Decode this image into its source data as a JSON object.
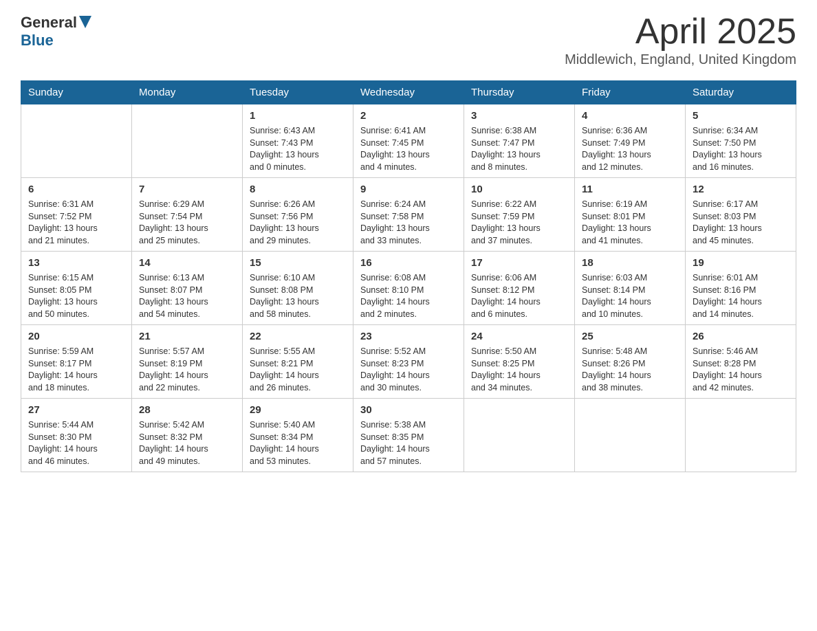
{
  "header": {
    "logo_general": "General",
    "logo_blue": "Blue",
    "title": "April 2025",
    "location": "Middlewich, England, United Kingdom"
  },
  "days_of_week": [
    "Sunday",
    "Monday",
    "Tuesday",
    "Wednesday",
    "Thursday",
    "Friday",
    "Saturday"
  ],
  "weeks": [
    {
      "days": [
        {
          "num": "",
          "info": ""
        },
        {
          "num": "",
          "info": ""
        },
        {
          "num": "1",
          "info": "Sunrise: 6:43 AM\nSunset: 7:43 PM\nDaylight: 13 hours\nand 0 minutes."
        },
        {
          "num": "2",
          "info": "Sunrise: 6:41 AM\nSunset: 7:45 PM\nDaylight: 13 hours\nand 4 minutes."
        },
        {
          "num": "3",
          "info": "Sunrise: 6:38 AM\nSunset: 7:47 PM\nDaylight: 13 hours\nand 8 minutes."
        },
        {
          "num": "4",
          "info": "Sunrise: 6:36 AM\nSunset: 7:49 PM\nDaylight: 13 hours\nand 12 minutes."
        },
        {
          "num": "5",
          "info": "Sunrise: 6:34 AM\nSunset: 7:50 PM\nDaylight: 13 hours\nand 16 minutes."
        }
      ]
    },
    {
      "days": [
        {
          "num": "6",
          "info": "Sunrise: 6:31 AM\nSunset: 7:52 PM\nDaylight: 13 hours\nand 21 minutes."
        },
        {
          "num": "7",
          "info": "Sunrise: 6:29 AM\nSunset: 7:54 PM\nDaylight: 13 hours\nand 25 minutes."
        },
        {
          "num": "8",
          "info": "Sunrise: 6:26 AM\nSunset: 7:56 PM\nDaylight: 13 hours\nand 29 minutes."
        },
        {
          "num": "9",
          "info": "Sunrise: 6:24 AM\nSunset: 7:58 PM\nDaylight: 13 hours\nand 33 minutes."
        },
        {
          "num": "10",
          "info": "Sunrise: 6:22 AM\nSunset: 7:59 PM\nDaylight: 13 hours\nand 37 minutes."
        },
        {
          "num": "11",
          "info": "Sunrise: 6:19 AM\nSunset: 8:01 PM\nDaylight: 13 hours\nand 41 minutes."
        },
        {
          "num": "12",
          "info": "Sunrise: 6:17 AM\nSunset: 8:03 PM\nDaylight: 13 hours\nand 45 minutes."
        }
      ]
    },
    {
      "days": [
        {
          "num": "13",
          "info": "Sunrise: 6:15 AM\nSunset: 8:05 PM\nDaylight: 13 hours\nand 50 minutes."
        },
        {
          "num": "14",
          "info": "Sunrise: 6:13 AM\nSunset: 8:07 PM\nDaylight: 13 hours\nand 54 minutes."
        },
        {
          "num": "15",
          "info": "Sunrise: 6:10 AM\nSunset: 8:08 PM\nDaylight: 13 hours\nand 58 minutes."
        },
        {
          "num": "16",
          "info": "Sunrise: 6:08 AM\nSunset: 8:10 PM\nDaylight: 14 hours\nand 2 minutes."
        },
        {
          "num": "17",
          "info": "Sunrise: 6:06 AM\nSunset: 8:12 PM\nDaylight: 14 hours\nand 6 minutes."
        },
        {
          "num": "18",
          "info": "Sunrise: 6:03 AM\nSunset: 8:14 PM\nDaylight: 14 hours\nand 10 minutes."
        },
        {
          "num": "19",
          "info": "Sunrise: 6:01 AM\nSunset: 8:16 PM\nDaylight: 14 hours\nand 14 minutes."
        }
      ]
    },
    {
      "days": [
        {
          "num": "20",
          "info": "Sunrise: 5:59 AM\nSunset: 8:17 PM\nDaylight: 14 hours\nand 18 minutes."
        },
        {
          "num": "21",
          "info": "Sunrise: 5:57 AM\nSunset: 8:19 PM\nDaylight: 14 hours\nand 22 minutes."
        },
        {
          "num": "22",
          "info": "Sunrise: 5:55 AM\nSunset: 8:21 PM\nDaylight: 14 hours\nand 26 minutes."
        },
        {
          "num": "23",
          "info": "Sunrise: 5:52 AM\nSunset: 8:23 PM\nDaylight: 14 hours\nand 30 minutes."
        },
        {
          "num": "24",
          "info": "Sunrise: 5:50 AM\nSunset: 8:25 PM\nDaylight: 14 hours\nand 34 minutes."
        },
        {
          "num": "25",
          "info": "Sunrise: 5:48 AM\nSunset: 8:26 PM\nDaylight: 14 hours\nand 38 minutes."
        },
        {
          "num": "26",
          "info": "Sunrise: 5:46 AM\nSunset: 8:28 PM\nDaylight: 14 hours\nand 42 minutes."
        }
      ]
    },
    {
      "days": [
        {
          "num": "27",
          "info": "Sunrise: 5:44 AM\nSunset: 8:30 PM\nDaylight: 14 hours\nand 46 minutes."
        },
        {
          "num": "28",
          "info": "Sunrise: 5:42 AM\nSunset: 8:32 PM\nDaylight: 14 hours\nand 49 minutes."
        },
        {
          "num": "29",
          "info": "Sunrise: 5:40 AM\nSunset: 8:34 PM\nDaylight: 14 hours\nand 53 minutes."
        },
        {
          "num": "30",
          "info": "Sunrise: 5:38 AM\nSunset: 8:35 PM\nDaylight: 14 hours\nand 57 minutes."
        },
        {
          "num": "",
          "info": ""
        },
        {
          "num": "",
          "info": ""
        },
        {
          "num": "",
          "info": ""
        }
      ]
    }
  ]
}
